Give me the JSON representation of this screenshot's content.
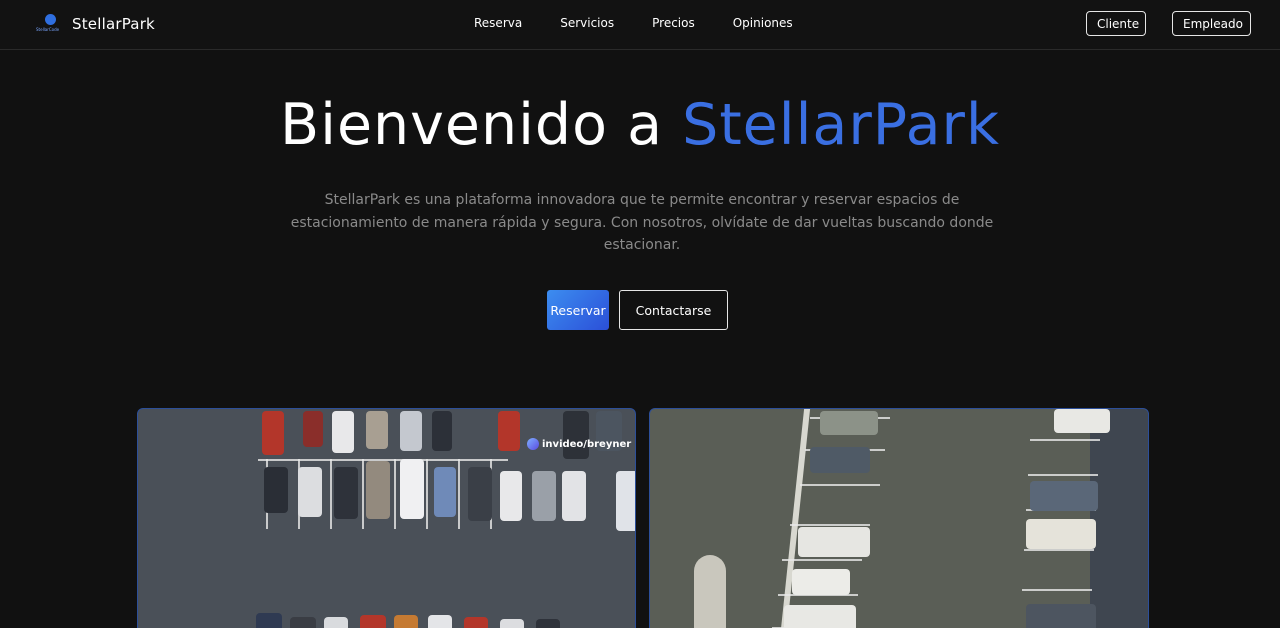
{
  "nav": {
    "brand": "StellarPark",
    "logo_text": "StellarCode",
    "links": [
      "Reserva",
      "Servicios",
      "Precios",
      "Opiniones"
    ],
    "cliente_label": "Cliente",
    "empleado_label": "Empleado"
  },
  "hero": {
    "title_prefix": "Bienvenido a",
    "title_accent": "StellarPark",
    "description": "StellarPark es una plataforma innovadora que te permite encontrar y reservar espacios de estacionamiento de manera rápida y segura. Con nosotros, olvídate de dar vueltas buscando donde estacionar.",
    "reservar_label": "Reservar",
    "contact_label": "Contactarse"
  },
  "gallery": {
    "watermark": "invideo/breyner"
  },
  "colors": {
    "accent": "#3a6fe2",
    "background": "#111111",
    "button_gradient_start": "#3c8df0",
    "button_gradient_end": "#2b4fd8"
  }
}
